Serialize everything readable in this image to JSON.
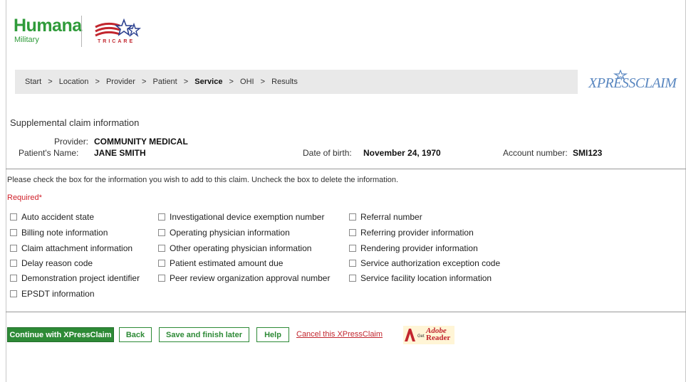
{
  "brand": {
    "name": "Humana",
    "sub": "Military",
    "partner_text": "TRICARE",
    "xpress_logo": "XPRESSCLAIM",
    "brand_green": "#2f9b3a",
    "accent_red": "#c2262e"
  },
  "breadcrumb": [
    {
      "label": "Start",
      "active": false
    },
    {
      "label": "Location",
      "active": false
    },
    {
      "label": "Provider",
      "active": false
    },
    {
      "label": "Patient",
      "active": false
    },
    {
      "label": "Service",
      "active": true
    },
    {
      "label": "OHI",
      "active": false
    },
    {
      "label": "Results",
      "active": false
    }
  ],
  "breadcrumb_sep": ">",
  "section": {
    "title": "Supplemental claim information",
    "provider_label": "Provider:",
    "provider_value": "COMMUNITY MEDICAL",
    "patient_label": "Patient's Name:",
    "patient_value": "JANE SMITH",
    "dob_label": "Date of birth:",
    "dob_value": "November 24, 1970",
    "account_label": "Account number:",
    "account_value": "SMI123"
  },
  "instructions": "Please check the box for the information you wish to add to this claim. Uncheck the box to delete the information.",
  "required_label": "Required*",
  "options": {
    "col1": [
      "Auto accident state",
      "Billing note information",
      "Claim attachment information",
      "Delay reason code",
      "Demonstration project identifier",
      "EPSDT information"
    ],
    "col2": [
      "Investigational device exemption number",
      "Operating physician information",
      "Other operating physician information",
      "Patient estimated amount due",
      "Peer review organization approval number"
    ],
    "col3": [
      "Referral number",
      "Referring provider information",
      "Rendering provider information",
      "Service authorization exception code",
      "Service facility location information"
    ]
  },
  "buttons": {
    "continue": "Continue with XPressClaim",
    "back": "Back",
    "save": "Save and finish later",
    "help": "Help",
    "cancel": "Cancel this XPressClaim"
  },
  "adobe": {
    "get": "Get",
    "word1": "Adobe",
    "word2": "Reader"
  }
}
